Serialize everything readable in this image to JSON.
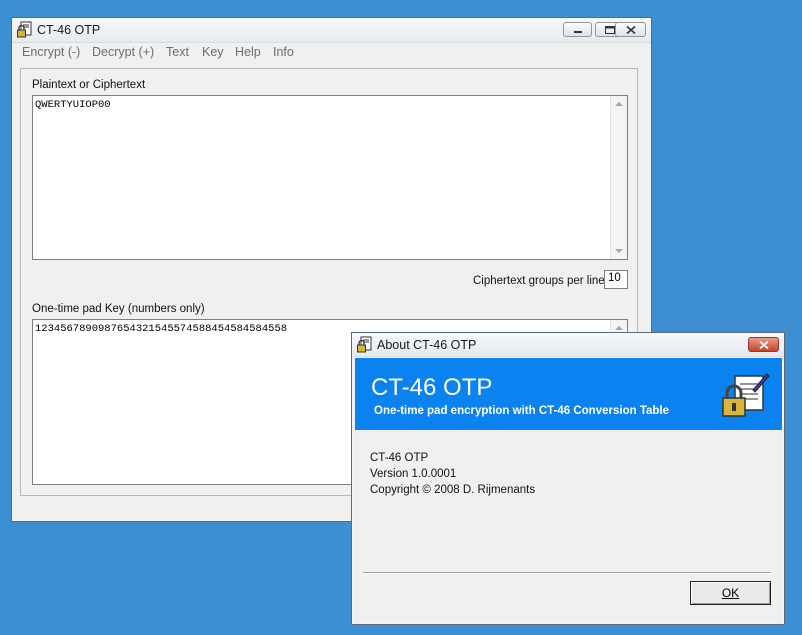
{
  "main_window": {
    "title": "CT-46 OTP",
    "menu": [
      "Encrypt (-)",
      "Decrypt (+)",
      "Text",
      "Key",
      "Help",
      "Info"
    ],
    "plaintext_label": "Plaintext or Ciphertext",
    "plaintext_value": "QWERTYUIOP00",
    "groups_label": "Ciphertext groups per line",
    "groups_value": "10",
    "key_label": "One-time pad Key (numbers only)",
    "key_value": "1234567890987654321545574588454584584558"
  },
  "about_dialog": {
    "title": "About CT-46 OTP",
    "banner_title": "CT-46 OTP",
    "banner_subtitle": "One-time pad encryption with CT-46 Conversion Table",
    "product": "CT-46 OTP",
    "version": "Version 1.0.0001",
    "copyright": "Copyright © 2008 D. Rijmenants",
    "ok_label": "OK"
  },
  "colors": {
    "desktop": "#3c8fd0",
    "banner": "#0a82f0",
    "close_button": "#c7432b"
  },
  "icons": [
    "padlock-document-icon",
    "minimize-icon",
    "maximize-icon",
    "close-icon"
  ]
}
